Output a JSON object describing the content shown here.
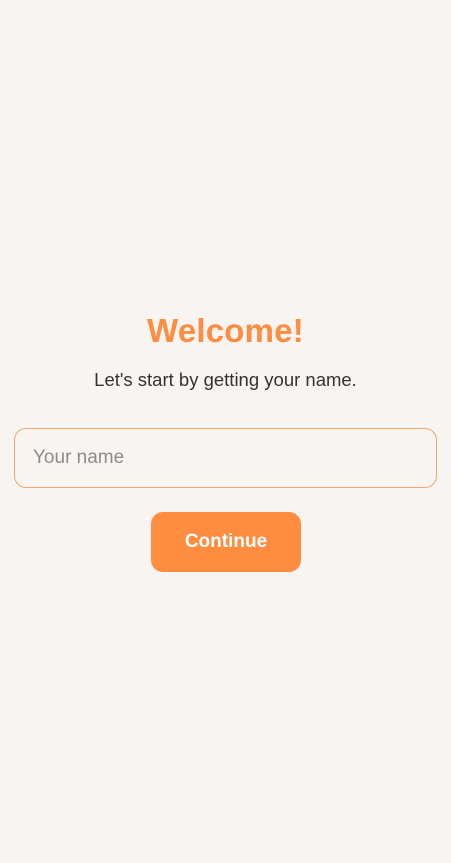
{
  "welcome": {
    "title": "Welcome!",
    "subtitle": "Let's start by getting your name.",
    "name_input": {
      "placeholder": "Your name",
      "value": ""
    },
    "continue_label": "Continue"
  },
  "colors": {
    "accent": "#ff8c3f",
    "background": "#f8f4f1",
    "input_border": "#f7a66c",
    "text": "#333333",
    "placeholder": "#8c8c8c"
  }
}
